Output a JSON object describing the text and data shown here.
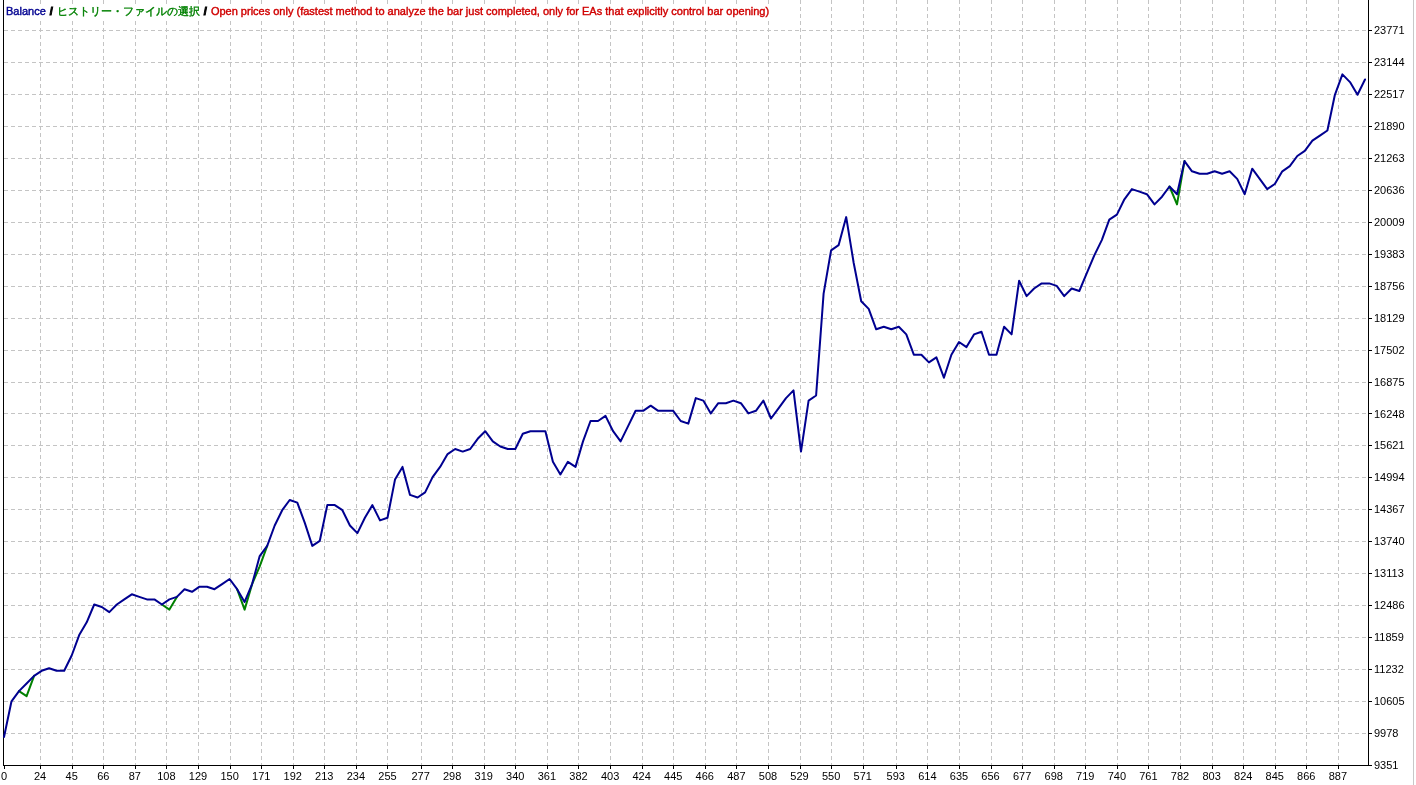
{
  "chart": {
    "legend": [
      {
        "kind": "separator",
        "text": "/",
        "color": "#000000"
      },
      {
        "kind": "text",
        "text": "ヒストリー・ファイルの選択",
        "color": "#008000"
      },
      {
        "kind": "separator",
        "text": "/",
        "color": "#000000"
      },
      {
        "kind": "text",
        "text": "Open prices only (fastest method to analyze the bar just completed, only for EAs that explicitly control bar opening)",
        "color": "#d00000"
      }
    ],
    "chart_data": {
      "type": "line",
      "grid": true,
      "xlim": [
        0,
        907
      ],
      "ylim": [
        9351,
        24301
      ],
      "xticks": [
        0,
        24,
        45,
        66,
        87,
        108,
        129,
        150,
        171,
        192,
        213,
        234,
        255,
        277,
        298,
        319,
        340,
        361,
        382,
        403,
        424,
        445,
        466,
        487,
        508,
        529,
        550,
        571,
        593,
        614,
        635,
        656,
        677,
        698,
        719,
        740,
        761,
        782,
        803,
        824,
        845,
        866,
        887
      ],
      "yticks": [
        9351,
        9978,
        10605,
        11232,
        11859,
        12486,
        13113,
        13740,
        14367,
        14994,
        15621,
        16248,
        16875,
        17502,
        18129,
        18756,
        19383,
        20009,
        20636,
        21263,
        21890,
        22517,
        23144,
        23771
      ],
      "x": [
        0,
        5,
        10,
        15,
        20,
        25,
        30,
        35,
        40,
        45,
        50,
        55,
        60,
        65,
        70,
        75,
        80,
        85,
        90,
        95,
        100,
        105,
        110,
        115,
        120,
        125,
        130,
        135,
        140,
        145,
        150,
        155,
        160,
        165,
        170,
        175,
        180,
        185,
        190,
        195,
        200,
        205,
        210,
        215,
        220,
        225,
        230,
        235,
        240,
        245,
        250,
        255,
        260,
        265,
        270,
        275,
        280,
        285,
        290,
        295,
        300,
        305,
        310,
        315,
        320,
        325,
        330,
        335,
        340,
        345,
        350,
        355,
        360,
        365,
        370,
        375,
        380,
        385,
        390,
        395,
        400,
        405,
        410,
        415,
        420,
        425,
        430,
        435,
        440,
        445,
        450,
        455,
        460,
        465,
        470,
        475,
        480,
        485,
        490,
        495,
        500,
        505,
        510,
        515,
        520,
        525,
        530,
        535,
        540,
        545,
        550,
        555,
        560,
        565,
        570,
        575,
        580,
        585,
        590,
        595,
        600,
        605,
        610,
        615,
        620,
        625,
        630,
        635,
        640,
        645,
        650,
        655,
        660,
        665,
        670,
        675,
        680,
        685,
        690,
        695,
        700,
        705,
        710,
        715,
        720,
        725,
        730,
        735,
        740,
        745,
        750,
        755,
        760,
        765,
        770,
        775,
        780,
        785,
        790,
        795,
        800,
        805,
        810,
        815,
        820,
        825,
        830,
        835,
        840,
        845,
        850,
        855,
        860,
        865,
        870,
        875,
        880,
        885,
        890,
        895,
        900,
        905
      ],
      "series": [
        {
          "name": "Balance",
          "color": "#000090",
          "values": [
            9900,
            10600,
            10800,
            10950,
            11100,
            11200,
            11250,
            11200,
            11200,
            11500,
            11900,
            12150,
            12500,
            12450,
            12350,
            12500,
            12600,
            12700,
            12650,
            12600,
            12600,
            12500,
            12600,
            12650,
            12800,
            12750,
            12850,
            12850,
            12800,
            12900,
            13000,
            12800,
            12550,
            12900,
            13450,
            13650,
            14050,
            14350,
            14550,
            14500,
            14100,
            13650,
            13750,
            14450,
            14450,
            14350,
            14050,
            13900,
            14200,
            14450,
            14150,
            14200,
            14950,
            15200,
            14650,
            14600,
            14700,
            15000,
            15200,
            15450,
            15550,
            15500,
            15550,
            15750,
            15900,
            15700,
            15600,
            15550,
            15550,
            15850,
            15900,
            15900,
            15900,
            15300,
            15050,
            15300,
            15200,
            15700,
            16100,
            16100,
            16200,
            15900,
            15700,
            16000,
            16300,
            16300,
            16400,
            16300,
            16300,
            16300,
            16100,
            16050,
            16550,
            16500,
            16250,
            16450,
            16450,
            16500,
            16450,
            16250,
            16300,
            16500,
            16150,
            16350,
            16550,
            16700,
            15500,
            16500,
            16600,
            18600,
            19450,
            19550,
            20100,
            19200,
            18450,
            18300,
            17900,
            17950,
            17900,
            17950,
            17800,
            17400,
            17400,
            17250,
            17350,
            16950,
            17400,
            17650,
            17550,
            17800,
            17850,
            17400,
            17400,
            17950,
            17800,
            18850,
            18550,
            18700,
            18800,
            18800,
            18750,
            18550,
            18700,
            18650,
            19000,
            19350,
            19650,
            20050,
            20150,
            20450,
            20650,
            20600,
            20550,
            20350,
            20500,
            20700,
            20550,
            21200,
            21000,
            20950,
            20950,
            21000,
            20950,
            21000,
            20850,
            20550,
            21050,
            20850,
            20650,
            20750,
            21000,
            21100,
            21300,
            21400,
            21600,
            21700,
            21800,
            22500,
            22900,
            22750,
            22500,
            22800
          ]
        },
        {
          "color": "#008000",
          "values": [
            null,
            null,
            10800,
            10700,
            11100,
            null,
            null,
            null,
            null,
            null,
            null,
            null,
            null,
            null,
            null,
            null,
            null,
            null,
            null,
            null,
            null,
            12500,
            12400,
            12650,
            null,
            null,
            null,
            null,
            null,
            null,
            null,
            12800,
            12400,
            12900,
            13250,
            13650,
            null,
            null,
            null,
            null,
            null,
            null,
            null,
            null,
            null,
            null,
            null,
            null,
            null,
            null,
            null,
            null,
            null,
            null,
            null,
            null,
            null,
            null,
            null,
            null,
            null,
            null,
            null,
            null,
            null,
            null,
            null,
            null,
            null,
            null,
            null,
            null,
            null,
            null,
            null,
            null,
            null,
            null,
            null,
            null,
            null,
            null,
            null,
            null,
            null,
            null,
            null,
            null,
            null,
            null,
            null,
            null,
            null,
            null,
            null,
            null,
            null,
            null,
            null,
            null,
            null,
            null,
            null,
            null,
            null,
            null,
            null,
            null,
            null,
            null,
            null,
            null,
            null,
            null,
            null,
            null,
            null,
            null,
            null,
            null,
            null,
            null,
            null,
            null,
            null,
            null,
            null,
            null,
            null,
            null,
            null,
            null,
            null,
            null,
            null,
            null,
            null,
            null,
            null,
            null,
            null,
            null,
            null,
            null,
            null,
            null,
            null,
            null,
            null,
            null,
            null,
            null,
            null,
            null,
            null,
            20700,
            20350,
            21200,
            null,
            null,
            null,
            null,
            null,
            null,
            null,
            null,
            null,
            null,
            null,
            null,
            null,
            null,
            null,
            null,
            null,
            null,
            null,
            null,
            null,
            null,
            null,
            null
          ]
        }
      ]
    }
  }
}
